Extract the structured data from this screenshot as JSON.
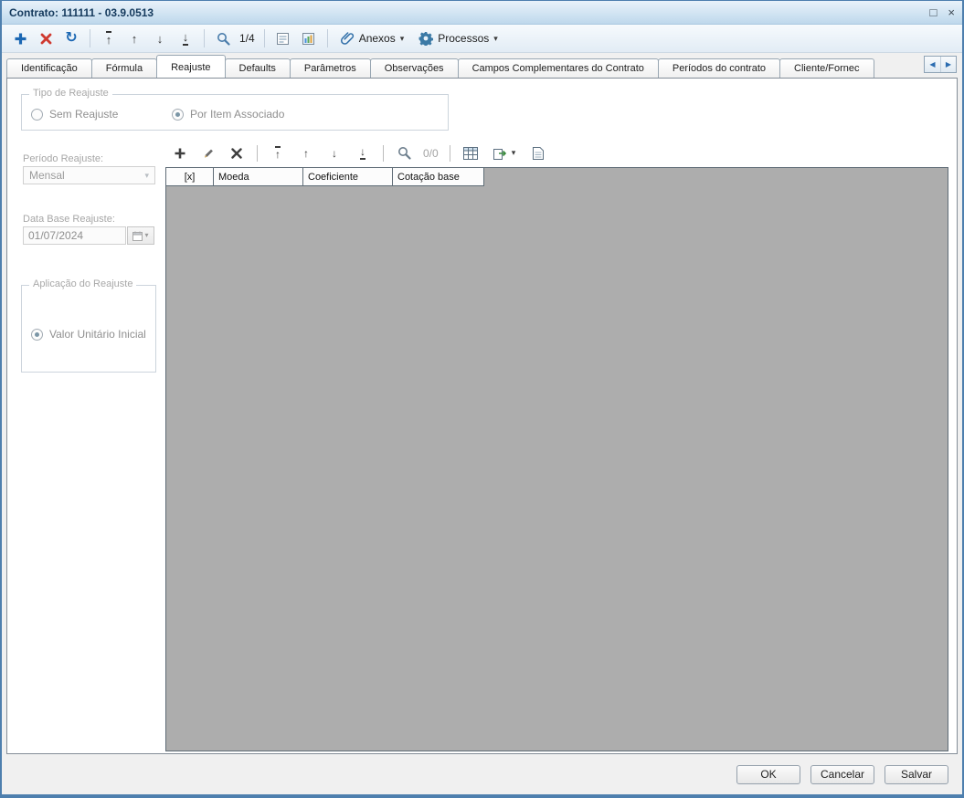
{
  "window": {
    "title": "Contrato: 111111 - 03.9.0513"
  },
  "icons": {
    "up_arrow": "↑",
    "down_arrow": "↓",
    "refresh": "↻",
    "chevron_down": "▾",
    "scroll_left": "◀",
    "scroll_right": "▶",
    "maximize": "□",
    "close": "×"
  },
  "toolbar": {
    "record_counter": "1/4",
    "anexos": "Anexos",
    "processos": "Processos"
  },
  "tabs": {
    "selected": "Reajuste",
    "items": [
      {
        "label": "Identificação"
      },
      {
        "label": "Fórmula"
      },
      {
        "label": "Reajuste"
      },
      {
        "label": "Defaults"
      },
      {
        "label": "Parâmetros"
      },
      {
        "label": "Observações"
      },
      {
        "label": "Campos Complementares do Contrato"
      },
      {
        "label": "Períodos do contrato"
      },
      {
        "label": "Cliente/Fornec"
      }
    ]
  },
  "reajuste": {
    "tipo_group": {
      "label": "Tipo de Reajuste",
      "options": [
        {
          "label": "Sem Reajuste",
          "checked": false
        },
        {
          "label": "Por Item Associado",
          "checked": true
        }
      ]
    },
    "periodo": {
      "label": "Período Reajuste:",
      "value": "Mensal"
    },
    "data_base": {
      "label": "Data Base Reajuste:",
      "value": "01/07/2024"
    },
    "aplicacao_group": {
      "label": "Aplicação do Reajuste",
      "options": [
        {
          "label": "Valor Unitário Inicial",
          "checked": true
        }
      ]
    }
  },
  "grid": {
    "counter": "0/0",
    "columns": [
      "[x]",
      "Moeda",
      "Coeficiente",
      "Cotação base"
    ]
  },
  "footer": {
    "ok": "OK",
    "cancel": "Cancelar",
    "save": "Salvar"
  }
}
